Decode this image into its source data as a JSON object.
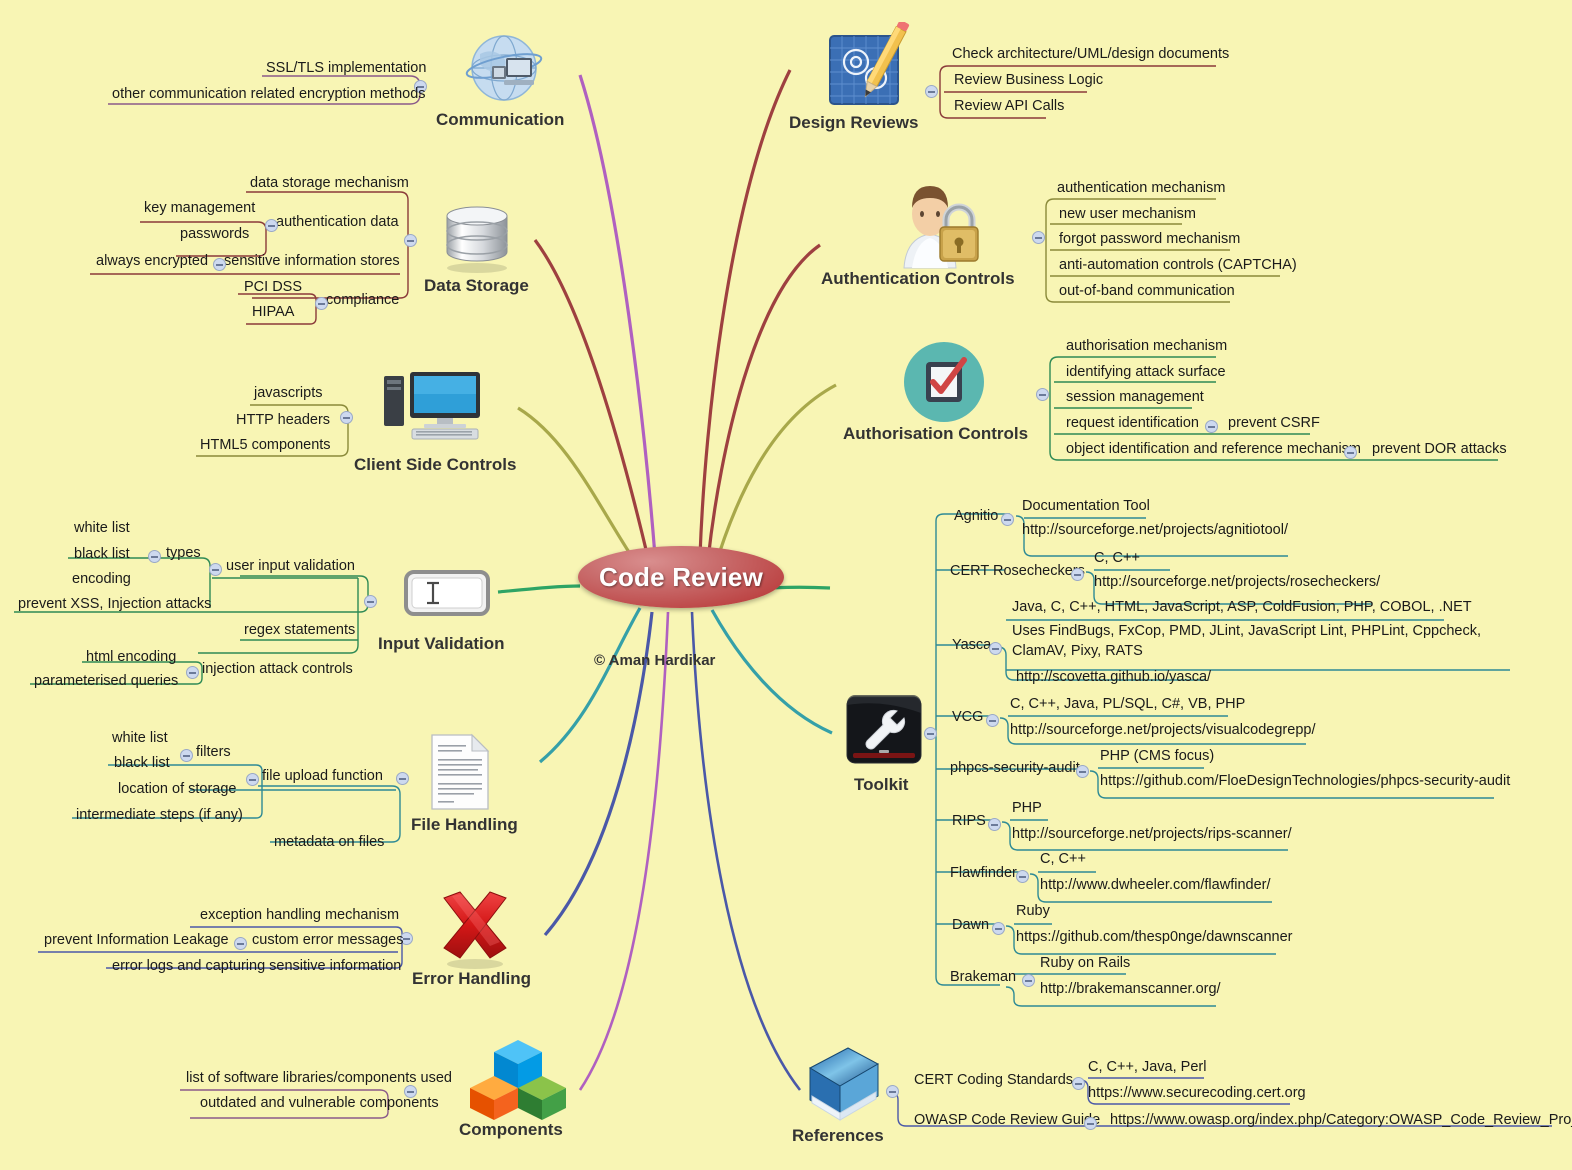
{
  "center": {
    "title": "Code Review",
    "copyright": "© Aman Hardikar"
  },
  "colors": {
    "background": "#f8f5b4",
    "center_fill": "#b63030",
    "communication": "#b060c0",
    "design_reviews": "#9e4040",
    "data_storage": "#a8a84a",
    "authentication": "#9e4040",
    "authorisation": "#a8a84a",
    "client_side": "#2ea465",
    "input_validation": "#2ea465",
    "toolkit": "#35a0a8",
    "file_handling": "#35a0a8",
    "error_handling": "#4a58a8",
    "components": "#b060c0",
    "references": "#4a58a8"
  },
  "branches": [
    {
      "id": "communication",
      "title": "Communication",
      "icon": "globe-network-icon",
      "leaves": [
        "SSL/TLS implementation",
        "other communication related encryption methods"
      ]
    },
    {
      "id": "data-storage",
      "title": "Data Storage",
      "icon": "database-icon",
      "leaves": [
        "data storage mechanism",
        "authentication data",
        "key management",
        "passwords",
        "sensitive information stores",
        "always encrypted",
        "compliance",
        "PCI DSS",
        "HIPAA"
      ]
    },
    {
      "id": "client-side-controls",
      "title": "Client Side Controls",
      "icon": "desktop-computer-icon",
      "leaves": [
        "javascripts",
        "HTTP headers",
        "HTML5 components"
      ]
    },
    {
      "id": "input-validation",
      "title": "Input Validation",
      "icon": "text-field-cursor-icon",
      "leaves": [
        "user input validation",
        "types",
        "white list",
        "black list",
        "encoding",
        "prevent XSS, Injection attacks",
        "regex statements",
        "injection attack controls",
        "html encoding",
        "parameterised queries"
      ]
    },
    {
      "id": "file-handling",
      "title": "File Handling",
      "icon": "document-page-icon",
      "leaves": [
        "file upload function",
        "filters",
        "white list",
        "black list",
        "location of storage",
        "intermediate steps (if any)",
        "metadata on files"
      ]
    },
    {
      "id": "error-handling",
      "title": "Error Handling",
      "icon": "red-cross-icon",
      "leaves": [
        "exception handling mechanism",
        "custom error messages",
        "prevent Information Leakage",
        "error logs and capturing sensitive information"
      ]
    },
    {
      "id": "components",
      "title": "Components",
      "icon": "cubes-icon",
      "leaves": [
        "list of software libraries/components used",
        "outdated and vulnerable components"
      ]
    },
    {
      "id": "design-reviews",
      "title": "Design Reviews",
      "icon": "blueprint-pencil-icon",
      "leaves": [
        "Check architecture/UML/design documents",
        "Review Business Logic",
        "Review API Calls"
      ]
    },
    {
      "id": "authentication-controls",
      "title": "Authentication Controls",
      "icon": "user-padlock-icon",
      "leaves": [
        "authentication mechanism",
        "new user mechanism",
        "forgot password mechanism",
        "anti-automation controls (CAPTCHA)",
        "out-of-band communication"
      ]
    },
    {
      "id": "authorisation-controls",
      "title": "Authorisation Controls",
      "icon": "checkbox-tick-icon",
      "leaves": [
        "authorisation mechanism",
        "identifying attack surface",
        "session management",
        "request identification",
        "prevent CSRF",
        "object identification and reference mechanism",
        "prevent DOR attacks"
      ]
    },
    {
      "id": "toolkit",
      "title": "Toolkit",
      "icon": "wrench-toolkit-icon",
      "tools": [
        {
          "name": "Agnitio",
          "lang": "Documentation Tool",
          "url": "http://sourceforge.net/projects/agnitiotool/"
        },
        {
          "name": "CERT Rosecheckers",
          "lang": "C, C++",
          "url": "http://sourceforge.net/projects/rosecheckers/"
        },
        {
          "name": "Yasca",
          "lang": "Java, C, C++, HTML, JavaScript, ASP, ColdFusion, PHP, COBOL, .NET",
          "uses": "Uses FindBugs, FxCop, PMD, JLint, JavaScript Lint, PHPLint, Cppcheck, ClamAV, Pixy, RATS",
          "url": "http://scovetta.github.io/yasca/"
        },
        {
          "name": "VCG",
          "lang": "C, C++, Java, PL/SQL, C#, VB, PHP",
          "url": "http://sourceforge.net/projects/visualcodegrepp/"
        },
        {
          "name": "phpcs-security-audit",
          "lang": "PHP (CMS focus)",
          "url": "https://github.com/FloeDesignTechnologies/phpcs-security-audit"
        },
        {
          "name": "RIPS",
          "lang": "PHP",
          "url": "http://sourceforge.net/projects/rips-scanner/"
        },
        {
          "name": "Flawfinder",
          "lang": "C, C++",
          "url": "http://www.dwheeler.com/flawfinder/"
        },
        {
          "name": "Dawn",
          "lang": "Ruby",
          "url": "https://github.com/thesp0nge/dawnscanner"
        },
        {
          "name": "Brakeman",
          "lang": "Ruby on Rails",
          "url": "http://brakemanscanner.org/"
        }
      ]
    },
    {
      "id": "references",
      "title": "References",
      "icon": "book-icon",
      "refs": [
        {
          "name": "CERT Coding Standards",
          "lang": "C, C++, Java, Perl",
          "url": "https://www.securecoding.cert.org"
        },
        {
          "name": "OWASP Code Review Guide",
          "url": "https://www.owasp.org/index.php/Category:OWASP_Code_Review_Project"
        }
      ]
    }
  ]
}
